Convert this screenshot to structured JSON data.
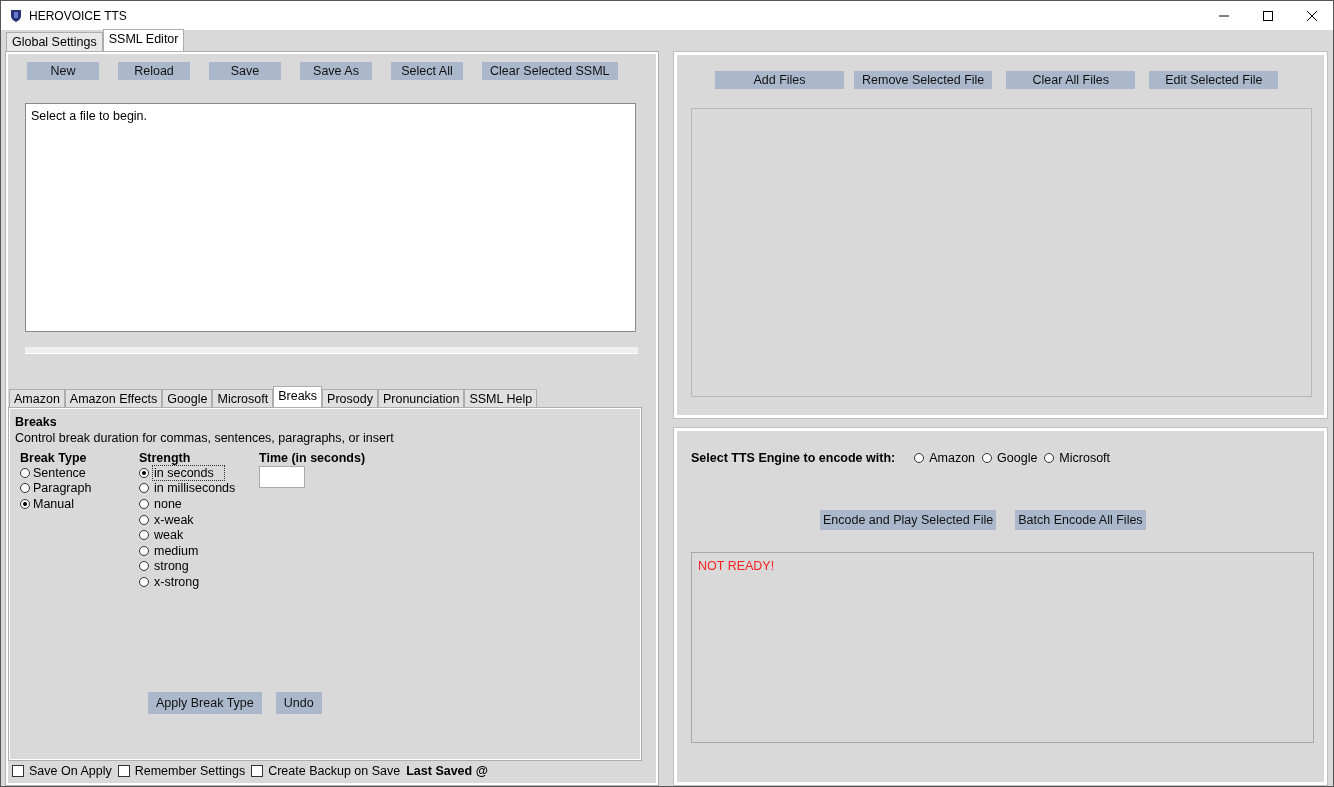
{
  "window": {
    "title": "HEROVOICE TTS"
  },
  "main_tabs": [
    {
      "label": "Global Settings",
      "selected": false
    },
    {
      "label": "SSML Editor",
      "selected": true
    }
  ],
  "editor": {
    "toolbar": [
      "New",
      "Reload",
      "Save",
      "Save As",
      "Select All",
      "Clear Selected SSML"
    ],
    "text": "Select a file to begin."
  },
  "ssml_tabs": [
    {
      "label": "Amazon",
      "selected": false
    },
    {
      "label": "Amazon Effects",
      "selected": false
    },
    {
      "label": "Google",
      "selected": false
    },
    {
      "label": "Microsoft",
      "selected": false
    },
    {
      "label": "Breaks",
      "selected": true
    },
    {
      "label": "Prosody",
      "selected": false
    },
    {
      "label": "Pronunciation",
      "selected": false
    },
    {
      "label": "SSML Help",
      "selected": false
    }
  ],
  "breaks": {
    "title": "Breaks",
    "description": "Control break duration for commas, sentences, paragraphs, or insert",
    "break_type": {
      "label": "Break Type",
      "options": [
        {
          "label": "Sentence",
          "selected": false
        },
        {
          "label": "Paragraph",
          "selected": false
        },
        {
          "label": "Manual",
          "selected": true
        }
      ]
    },
    "strength": {
      "label": "Strength",
      "options": [
        {
          "label": "in seconds",
          "selected": true
        },
        {
          "label": "in milliseconds",
          "selected": false
        },
        {
          "label": "none",
          "selected": false
        },
        {
          "label": "x-weak",
          "selected": false
        },
        {
          "label": "weak",
          "selected": false
        },
        {
          "label": "medium",
          "selected": false
        },
        {
          "label": "strong",
          "selected": false
        },
        {
          "label": "x-strong",
          "selected": false
        }
      ]
    },
    "time": {
      "label": "Time (in seconds)"
    },
    "buttons": [
      "Apply Break Type",
      "Undo"
    ]
  },
  "options": [
    {
      "label": "Save On Apply",
      "checked": false
    },
    {
      "label": "Remember Settings",
      "checked": false
    },
    {
      "label": "Create Backup on Save",
      "checked": false
    }
  ],
  "last_saved": "Last Saved @",
  "files": {
    "buttons": [
      "Add Files",
      "Remove Selected File",
      "Clear All Files",
      "Edit Selected File"
    ]
  },
  "encode": {
    "label": "Select TTS Engine to encode with:",
    "engines": [
      {
        "label": "Amazon",
        "selected": false
      },
      {
        "label": "Google",
        "selected": false
      },
      {
        "label": "Microsoft",
        "selected": false
      }
    ],
    "buttons": [
      "Encode and Play Selected File",
      "Batch Encode All Files"
    ],
    "status": "NOT READY!"
  }
}
